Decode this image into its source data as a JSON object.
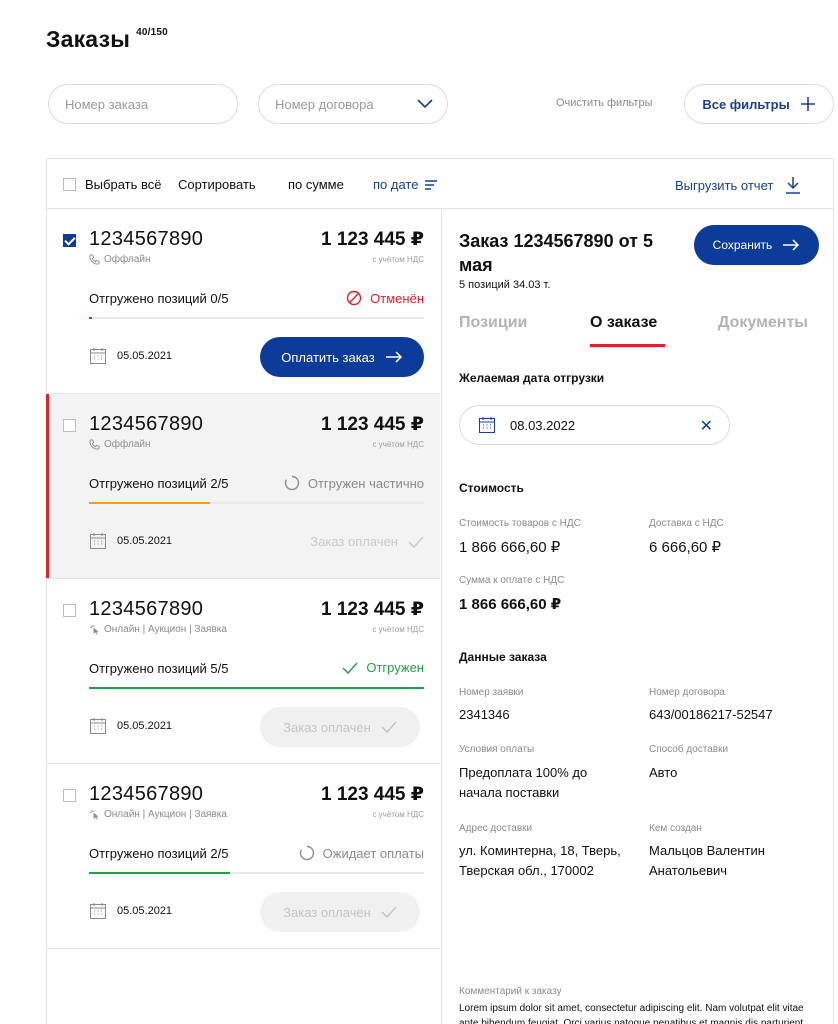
{
  "page": {
    "title": "Заказы",
    "count": "40/150"
  },
  "filters": {
    "order_placeholder": "Номер заказа",
    "contract_placeholder": "Номер договора",
    "clear_label": "Очистить фильтры",
    "all_label": "Все фильтры"
  },
  "toolbar": {
    "select_all": "Выбрать всё",
    "sort_label": "Сортировать",
    "by_sum": "по сумме",
    "by_date": "по дате",
    "export": "Выгрузить отчет"
  },
  "orders": [
    {
      "number": "1234567890",
      "channel": "Оффлайн",
      "sum": "1 123 445 ₽",
      "vat": "с учётом НДС",
      "shipped": "Отгружено позиций 0/5",
      "status": "Отменён",
      "progress": 0.01,
      "date": "05.05.2021",
      "action": "Оплатить заказ",
      "checked": true
    },
    {
      "number": "1234567890",
      "channel": "Оффлайн",
      "sum": "1 123 445 ₽",
      "vat": "с учётом НДС",
      "shipped": "Отгружено позиций 2/5",
      "status": "Отгружен частично",
      "progress": 0.36,
      "date": "05.05.2021",
      "action": "Заказ оплачен",
      "checked": false
    },
    {
      "number": "1234567890",
      "channel": "Онлайн | Аукцион | Заявка",
      "sum": "1 123 445 ₽",
      "vat": "с учётом НДС",
      "shipped": "Отгружено позиций 5/5",
      "status": "Отгружен",
      "progress": 1.0,
      "date": "05.05.2021",
      "action": "Заказ оплачен",
      "checked": false
    },
    {
      "number": "1234567890",
      "channel": "Онлайн | Аукцион | Заявка",
      "sum": "1 123 445 ₽",
      "vat": "с учётом НДС",
      "shipped": "Отгружено позиций 2/5",
      "status": "Ожидает оплаты",
      "progress": 0.42,
      "date": "05.05.2021",
      "action": "Заказ оплачен",
      "checked": false
    }
  ],
  "detail": {
    "title": "Заказ 1234567890 от 5 мая",
    "subtitle": "5 позиций 34.03 т.",
    "save": "Сохранить",
    "tabs": [
      "Позиции",
      "О заказе",
      "Документы"
    ],
    "ship_date_heading": "Желаемая дата отгрузки",
    "ship_date": "08.03.2022",
    "cost_heading": "Стоимость",
    "goods_cost_label": "Стоимость товаров с НДС",
    "goods_cost": "1 866 666,60 ₽",
    "delivery_cost_label": "Доставка с НДС",
    "delivery_cost": "6 666,60 ₽",
    "total_label": "Сумма к оплате с НДС",
    "total": "1 866 666,60 ₽",
    "data_heading": "Данные заказа",
    "request_label": "Номер заявки",
    "request": "2341346",
    "contract_label": "Номер договора",
    "contract": "643/00186217-52547",
    "payment_label": "Условия оплаты",
    "payment": "Предоплата 100% до начала поставки",
    "delivery_method_label": "Способ доставки",
    "delivery_method": "Авто",
    "address_label": "Адрес доставки",
    "address": "ул. Коминтерна, 18, Тверь, Тверская обл., 170002",
    "creator_label": "Кем создан",
    "creator": "Мальцов Валентин Анатольевич",
    "comment_label": "Комментарий к заказу",
    "comment": "Lorem ipsum dolor sit amet, consectetur adipiscing elit. Nam volutpat elit vitae ante bibendum feugiat. Orci varius natoque penatibus et magnis dis parturient montes"
  },
  "colors": {
    "primary": "#0d3b9a",
    "accent_red": "#e5202a",
    "success": "#24a148",
    "partial": "#f0a020"
  }
}
